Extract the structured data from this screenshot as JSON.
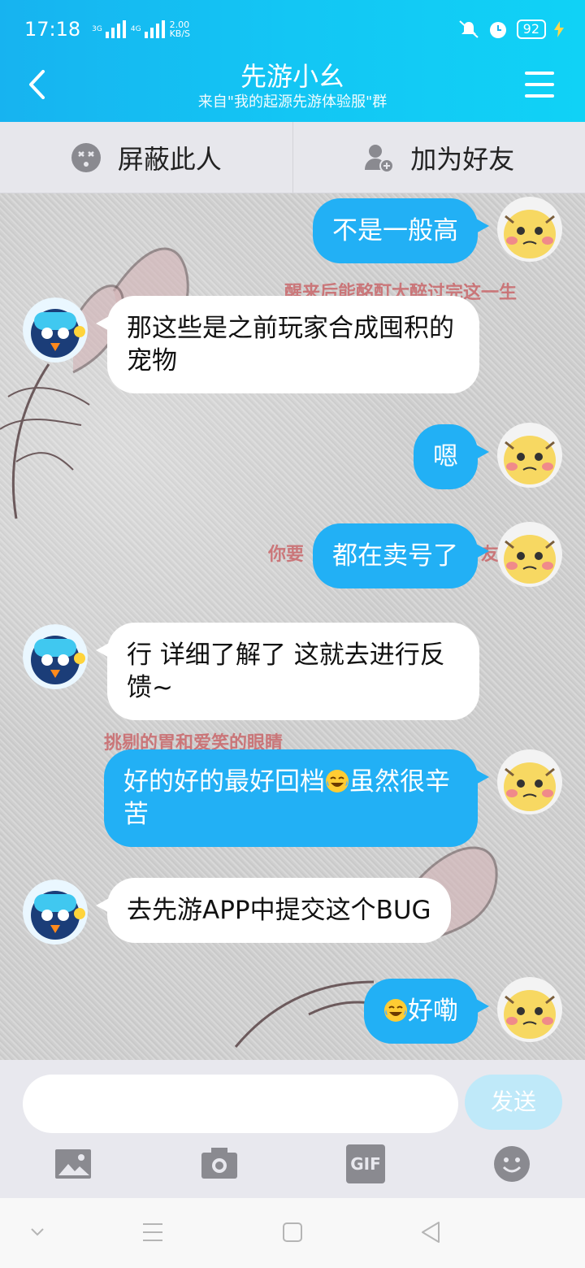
{
  "status": {
    "time": "17:18",
    "net1": "3G",
    "net2": "4G",
    "speed": "2.00",
    "speed_unit": "KB/S",
    "battery": "92"
  },
  "header": {
    "title": "先游小幺",
    "subtitle": "来自\"我的起源先游体验服\"群"
  },
  "actions": {
    "block_label": "屏蔽此人",
    "add_friend_label": "加为好友"
  },
  "background_text": [
    "醒来后能酩酊大醉过完这一生",
    "你要",
    "友",
    "挑剔的胃和爱笑的眼睛"
  ],
  "messages": [
    {
      "dir": "out",
      "text": "不是一般高"
    },
    {
      "dir": "in",
      "text": "那这些是之前玩家合成囤积的宠物"
    },
    {
      "dir": "out",
      "text": "嗯"
    },
    {
      "dir": "out",
      "text": "都在卖号了"
    },
    {
      "dir": "in",
      "text": "行 详细了解了 这就去进行反馈~"
    },
    {
      "dir": "out",
      "text_before": "好的好的最好回档",
      "emoji": "tears-of-joy",
      "text_after": "虽然很辛苦"
    },
    {
      "dir": "in",
      "text": "去先游APP中提交这个BUG"
    },
    {
      "dir": "out",
      "emoji": "tears-of-joy",
      "text_after": "好嘞"
    }
  ],
  "input": {
    "placeholder": "",
    "send_label": "发送"
  },
  "tools": [
    "image-icon",
    "camera-icon",
    "gif-icon",
    "emoji-icon"
  ],
  "tool_gif_label": "GIF",
  "colors": {
    "header": "#17b3f0",
    "bubble_out": "#22b0f5",
    "bubble_in": "#ffffff"
  }
}
